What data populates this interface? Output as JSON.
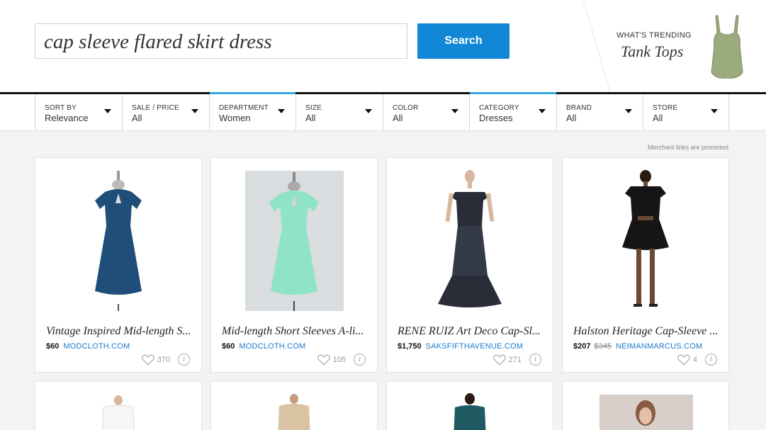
{
  "search": {
    "query": "cap sleeve flared skirt dress",
    "button_label": "Search"
  },
  "trending": {
    "label": "WHAT'S TRENDING",
    "value": "Tank Tops"
  },
  "filters": [
    {
      "label": "SORT BY",
      "value": "Relevance"
    },
    {
      "label": "SALE / PRICE",
      "value": "All"
    },
    {
      "label": "DEPARTMENT",
      "value": "Women",
      "active": true
    },
    {
      "label": "SIZE",
      "value": "All"
    },
    {
      "label": "COLOR",
      "value": "All"
    },
    {
      "label": "CATEGORY",
      "value": "Dresses",
      "active": true
    },
    {
      "label": "BRAND",
      "value": "All"
    },
    {
      "label": "STORE",
      "value": "All"
    }
  ],
  "promo_note": "Merchant links are promoted",
  "products": [
    {
      "title": "Vintage Inspired Mid-length S...",
      "price": "$60",
      "old_price": "",
      "store": "MODCLOTH.COM",
      "favorites": "370",
      "color": "#1f4f78"
    },
    {
      "title": "Mid-length Short Sleeves A-li...",
      "price": "$60",
      "old_price": "",
      "store": "MODCLOTH.COM",
      "favorites": "105",
      "color": "#8fe3c6"
    },
    {
      "title": "RENE RUIZ Art Deco Cap-Sl...",
      "price": "$1,750",
      "old_price": "",
      "store": "SAKSFIFTHAVENUE.COM",
      "favorites": "271",
      "color": "#2a2d38"
    },
    {
      "title": "Halston Heritage Cap-Sleeve ...",
      "price": "$207",
      "old_price": "$345",
      "store": "NEIMANMARCUS.COM",
      "favorites": "4",
      "color": "#151515"
    }
  ],
  "colors": {
    "accent": "#1287d6",
    "active_tab": "#34a8e0",
    "link": "#1f7ac9"
  }
}
